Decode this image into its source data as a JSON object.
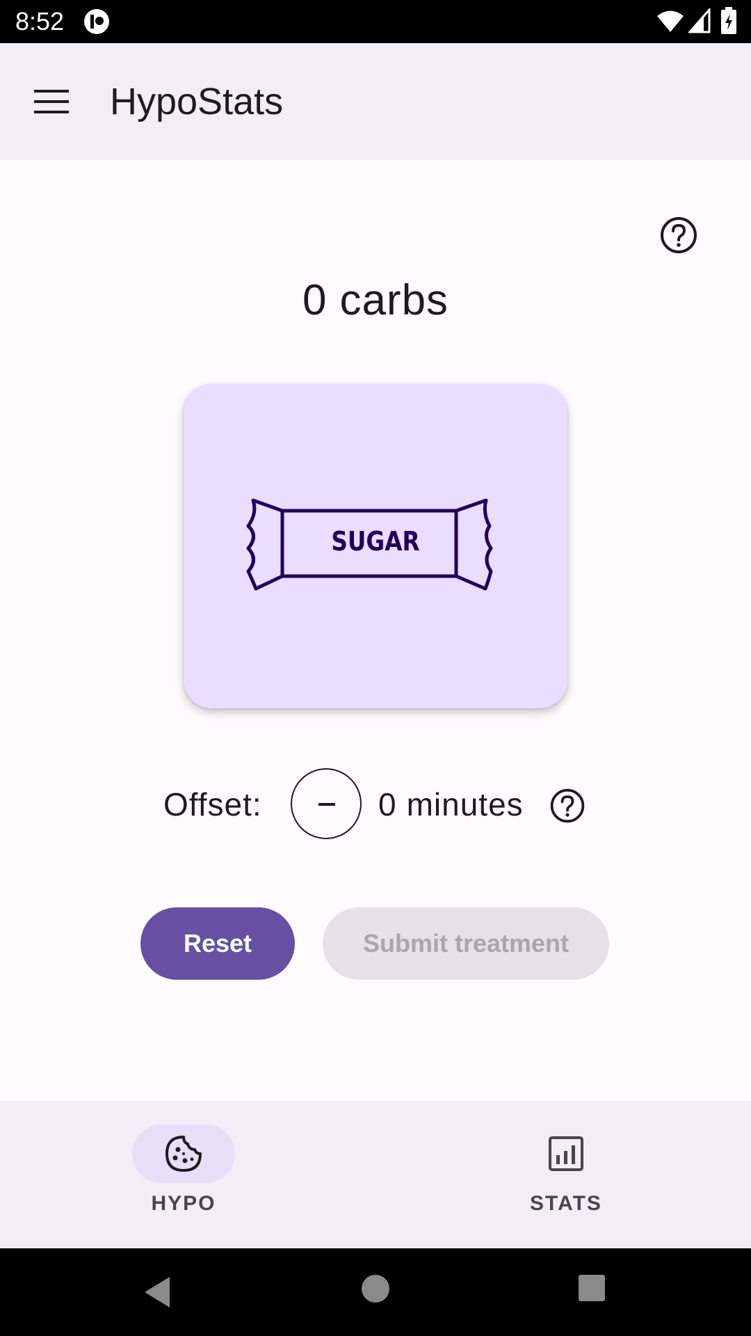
{
  "status_bar": {
    "time": "8:52",
    "icons": [
      "app-notification-icon",
      "wifi-icon",
      "signal-icon",
      "battery-icon"
    ]
  },
  "app_bar": {
    "title": "HypoStats",
    "menu_icon": "menu-icon"
  },
  "main": {
    "help_icon": "help-icon",
    "carbs_value": "0",
    "carbs_unit": "carbs",
    "sugar_card": {
      "label": "SUGAR",
      "icon": "sugar-candy-icon"
    },
    "offset": {
      "label": "Offset:",
      "value": "0",
      "unit": "minutes",
      "decrement_icon": "minus-icon",
      "help_icon": "help-icon"
    },
    "buttons": {
      "reset_label": "Reset",
      "submit_label": "Submit treatment",
      "submit_enabled": false
    }
  },
  "bottom_nav": {
    "items": [
      {
        "label": "HYPO",
        "icon": "cookie-icon",
        "selected": true
      },
      {
        "label": "STATS",
        "icon": "bar-chart-icon",
        "selected": false
      }
    ]
  },
  "system_nav": {
    "icons": [
      "back-icon",
      "home-icon",
      "recents-icon"
    ]
  },
  "colors": {
    "primary": "#6750a4",
    "card": "#eaddff",
    "surface": "#fffbfe",
    "bar_surface": "#f3edf7",
    "on_surface": "#1d1b20",
    "candy_outline": "#21005d",
    "disabled_bg": "#e6e0e9",
    "disabled_text": "#aaa5ae"
  }
}
